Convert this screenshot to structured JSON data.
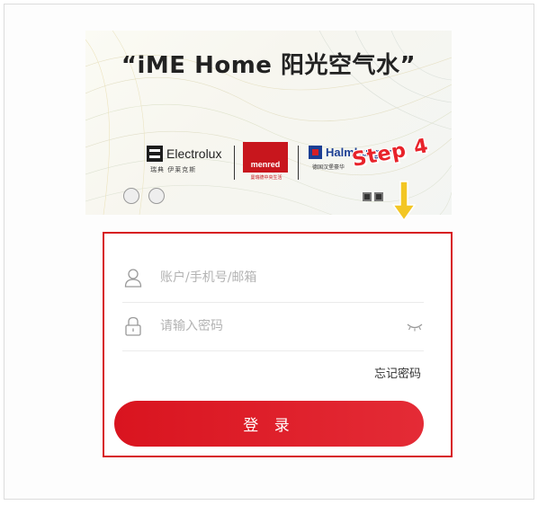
{
  "banner": {
    "title": "“iME Home  阳光空气水”",
    "brands": {
      "electrolux": {
        "name": "Electrolux",
        "sub": "瑞典 伊莱克斯"
      },
      "menred": {
        "name": "menred",
        "sub": "曼瑞德中央生活"
      },
      "halmburger": {
        "name": "Halmburger",
        "sub": "德国汉堡豪华"
      }
    }
  },
  "annotation": {
    "step_label": "Step 4",
    "color": "#e8232b",
    "arrow_color": "#f3c623"
  },
  "login": {
    "account_placeholder": "账户/手机号/邮箱",
    "password_placeholder": "请输入密码",
    "forgot_label": "忘记密码",
    "login_label": "登 录",
    "accent_color": "#d9141f",
    "highlight_border": "#d71a21"
  },
  "icons": {
    "account": "user-icon",
    "password": "lock-icon",
    "toggle": "eye-closed-icon"
  }
}
